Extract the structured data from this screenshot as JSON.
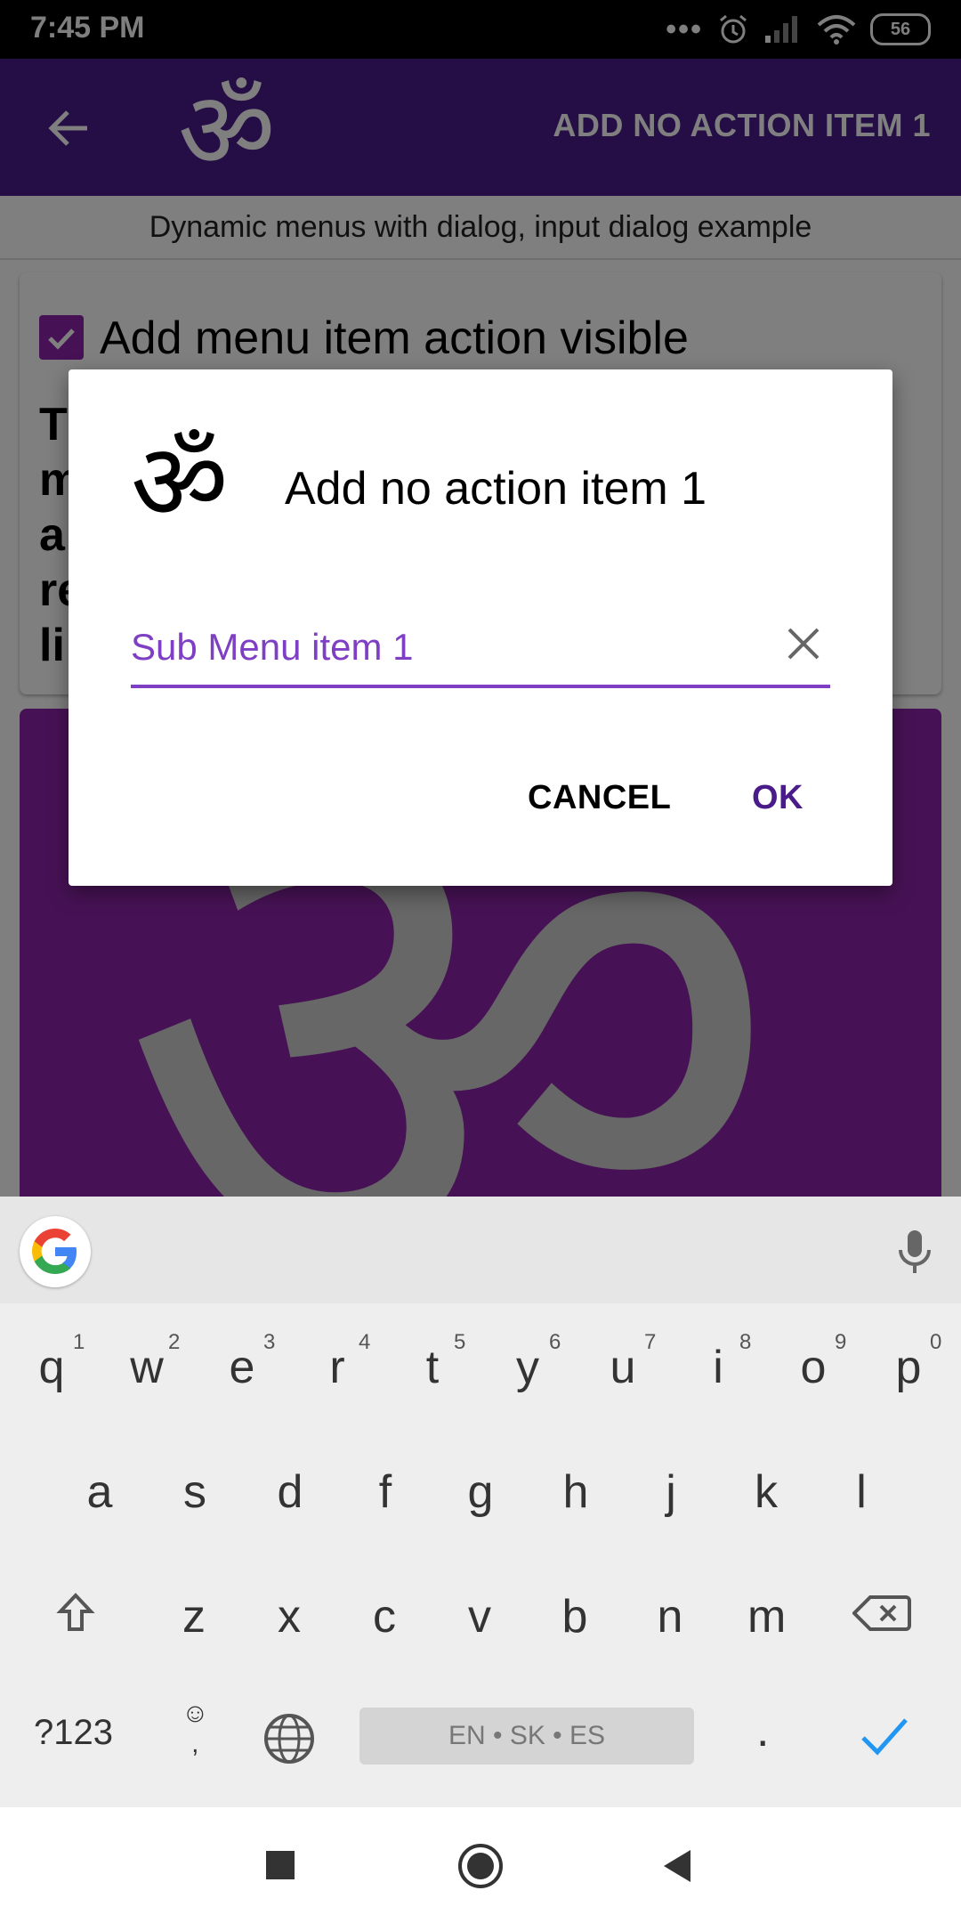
{
  "status_bar": {
    "time": "7:45 PM",
    "battery": "56"
  },
  "toolbar": {
    "action_label": "ADD NO ACTION ITEM 1",
    "logo_glyph": "ॐ"
  },
  "content": {
    "subtitle": "Dynamic menus with dialog, input dialog example",
    "checkbox_label": "Add menu item action visible",
    "card_text": "T\nm\na\nre\nli"
  },
  "dialog": {
    "icon_glyph": "ॐ",
    "title": "Add no action item 1",
    "input_value": "Sub Menu item 1",
    "cancel_label": "CANCEL",
    "ok_label": "OK"
  },
  "keyboard": {
    "row1": [
      "q",
      "w",
      "e",
      "r",
      "t",
      "y",
      "u",
      "i",
      "o",
      "p"
    ],
    "row1_hints": [
      "1",
      "2",
      "3",
      "4",
      "5",
      "6",
      "7",
      "8",
      "9",
      "0"
    ],
    "row2": [
      "a",
      "s",
      "d",
      "f",
      "g",
      "h",
      "j",
      "k",
      "l"
    ],
    "row3": [
      "z",
      "x",
      "c",
      "v",
      "b",
      "n",
      "m"
    ],
    "symbols_key": "?123",
    "comma_key": ",",
    "spacebar_label": "EN • SK • ES",
    "period_key": "."
  },
  "colors": {
    "primary": "#4a1c8a",
    "accent": "#8e24aa",
    "input_accent": "#7e3fc4"
  }
}
